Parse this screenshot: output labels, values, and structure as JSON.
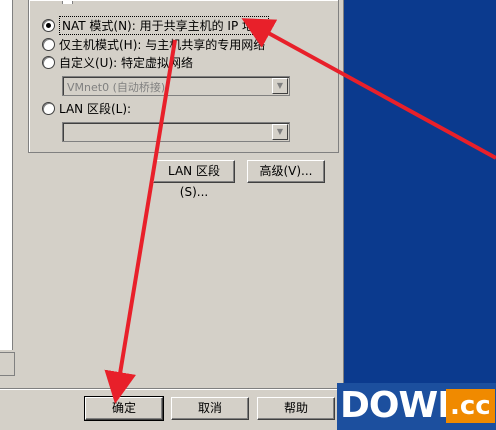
{
  "network": {
    "options": [
      {
        "label": "NAT 模式(N): 用于共享主机的 IP 地址",
        "selected": true
      },
      {
        "label": "仅主机模式(H): 与主机共享的专用网络",
        "selected": false
      },
      {
        "label": "自定义(U): 特定虚拟网络",
        "selected": false
      },
      {
        "label": "LAN 区段(L):",
        "selected": false
      }
    ],
    "custom_select_value": "VMnet0 (自动桥接)",
    "lan_select_value": ""
  },
  "group_buttons": {
    "lan_segments": "LAN 区段(S)...",
    "advanced": "高级(V)..."
  },
  "footer_buttons": {
    "ok": "确定",
    "cancel": "取消",
    "help": "帮助"
  },
  "watermark": {
    "text": "DOWN",
    "suffix": ".cc"
  },
  "colors": {
    "annotation_arrow": "#e8202a",
    "desktop": "#0b3a8e",
    "dialog": "#d4d0c8"
  }
}
